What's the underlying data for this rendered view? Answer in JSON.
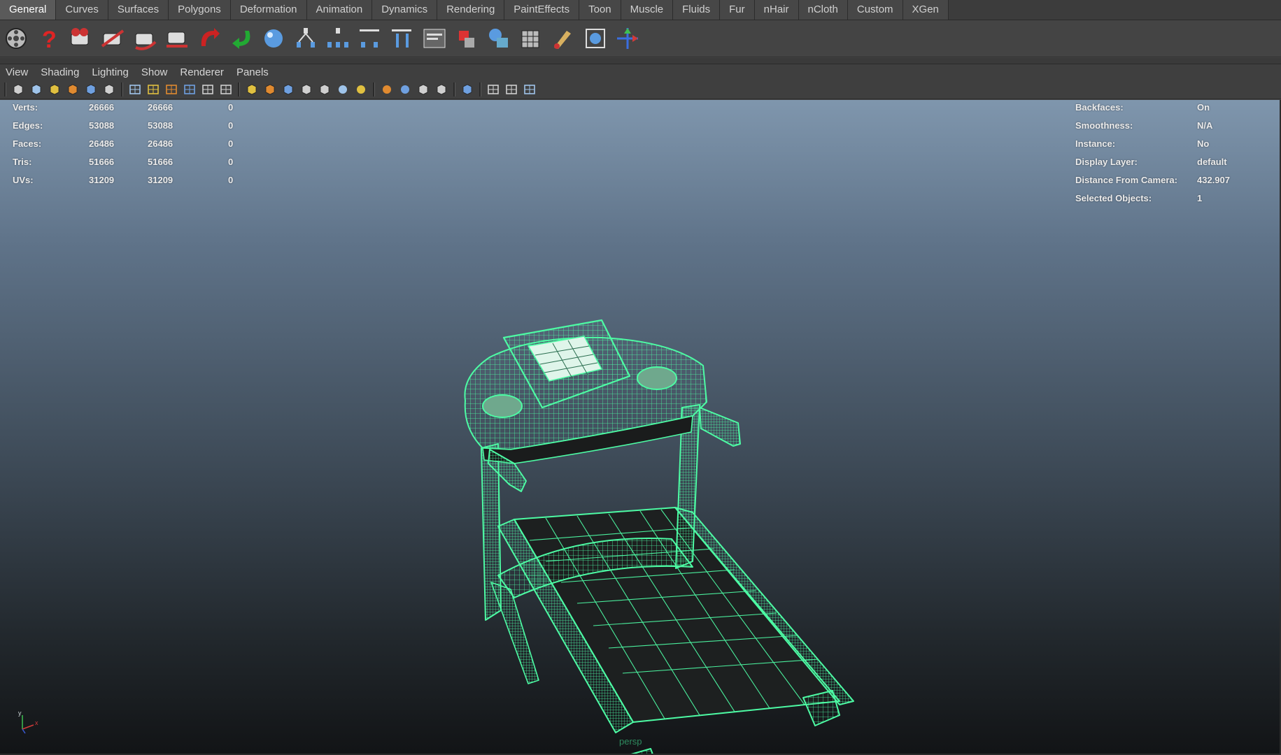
{
  "shelf": {
    "tabs": [
      "General",
      "Curves",
      "Surfaces",
      "Polygons",
      "Deformation",
      "Animation",
      "Dynamics",
      "Rendering",
      "PaintEffects",
      "Toon",
      "Muscle",
      "Fluids",
      "Fur",
      "nHair",
      "nCloth",
      "Custom",
      "XGen"
    ],
    "active_tab": "General",
    "icons": [
      "film-reel",
      "help-question",
      "camera-aim",
      "camera-aim-up",
      "camera-rotate",
      "camera-track",
      "undo-arrow",
      "redo-arrow",
      "sphere-blue",
      "hierarchy-1",
      "hierarchy-2",
      "hierarchy-3",
      "hierarchy-4",
      "window-editor",
      "render-red-cube",
      "render-sphere-cube",
      "cube-grid",
      "paint-brush",
      "cube-lattice",
      "move-manipulator"
    ]
  },
  "panel_menu": {
    "items": [
      "View",
      "Shading",
      "Lighting",
      "Show",
      "Renderer",
      "Panels"
    ]
  },
  "panel_toolbar": {
    "groups": [
      [
        "select-camera",
        "camera-attributes",
        "bookmark",
        "image-plane",
        "2d-pan-zoom",
        "grease-pencil"
      ],
      [
        "grid",
        "film-gate",
        "resolution-gate",
        "gate-mask",
        "field-chart",
        "safe-title"
      ],
      [
        "wireframe",
        "smooth-shade",
        "wireframe-on-shaded",
        "default-material",
        "textured",
        "use-all-lights",
        "shadows"
      ],
      [
        "screen-ssao",
        "motion-blur",
        "anti-alias",
        "depth-of-field"
      ],
      [
        "isolate-select"
      ],
      [
        "xray",
        "xray-joints",
        "xray-components"
      ]
    ]
  },
  "hud_left": {
    "rows": [
      {
        "label": "Verts:",
        "v1": "26666",
        "v2": "26666",
        "v3": "0"
      },
      {
        "label": "Edges:",
        "v1": "53088",
        "v2": "53088",
        "v3": "0"
      },
      {
        "label": "Faces:",
        "v1": "26486",
        "v2": "26486",
        "v3": "0"
      },
      {
        "label": "Tris:",
        "v1": "51666",
        "v2": "51666",
        "v3": "0"
      },
      {
        "label": "UVs:",
        "v1": "31209",
        "v2": "31209",
        "v3": "0"
      }
    ]
  },
  "hud_right": {
    "rows": [
      {
        "label": "Backfaces:",
        "value": "On"
      },
      {
        "label": "Smoothness:",
        "value": "N/A"
      },
      {
        "label": "Instance:",
        "value": "No"
      },
      {
        "label": "Display Layer:",
        "value": "default"
      },
      {
        "label": "Distance From Camera:",
        "value": "432.907"
      },
      {
        "label": "Selected Objects:",
        "value": "1"
      }
    ]
  },
  "viewport": {
    "camera_label": "persp",
    "axis_labels": {
      "x": "x",
      "y": "y"
    },
    "wireframe_color": "#4dfba4",
    "object": "treadmill-mesh"
  },
  "colors": {
    "ui_bg": "#444444",
    "tab_active": "#5a5a5a",
    "wire": "#4dfba4",
    "hud_text": "#ececec"
  }
}
